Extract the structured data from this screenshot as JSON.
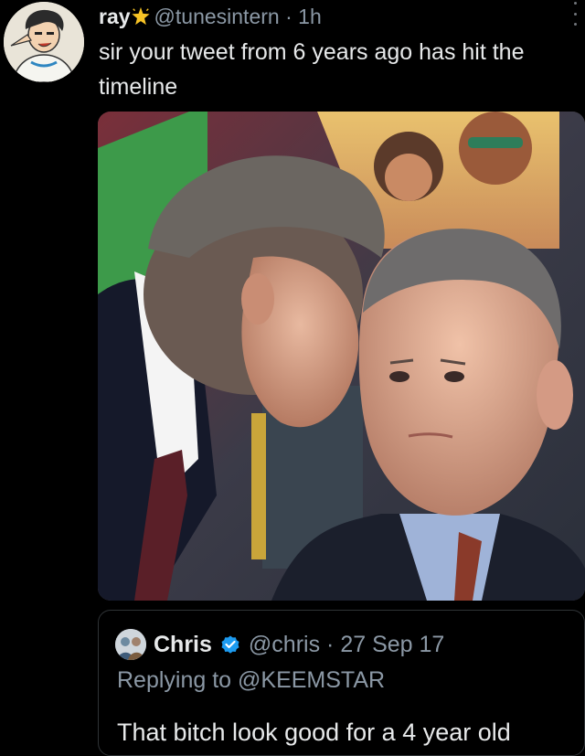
{
  "tweet": {
    "display_name": "ray",
    "name_emoji": "sparkle-star-icon",
    "handle": "@tunesintern",
    "separator": "·",
    "time": "1h",
    "text": "sir your tweet from 6 years ago has hit the timeline"
  },
  "media": {
    "kind": "photo"
  },
  "quoted_tweet": {
    "display_name": "Chris",
    "verified": true,
    "handle": "@chris",
    "separator": "·",
    "date": "27 Sep 17",
    "replying_prefix": "Replying to",
    "replying_to": "@KEEMSTAR",
    "text": "That bitch look good for a 4 year old"
  },
  "colors": {
    "background": "#000000",
    "primary_text": "#e7e9ea",
    "secondary_text": "#8b98a5",
    "verified_blue": "#1d9bf0",
    "border": "#2f3336"
  }
}
